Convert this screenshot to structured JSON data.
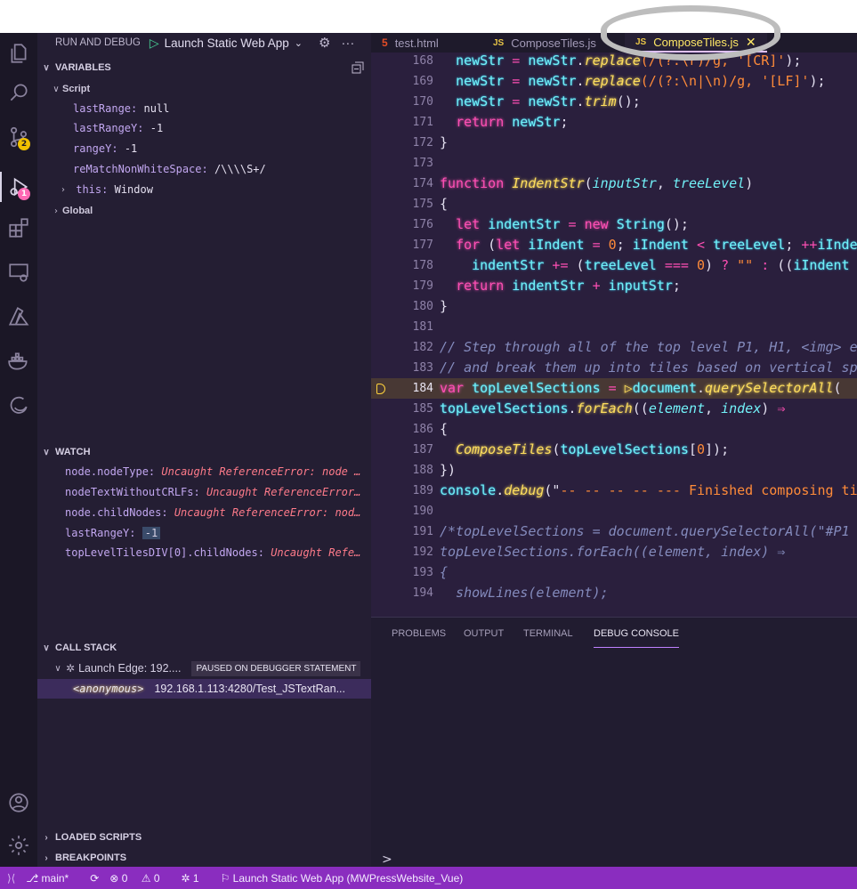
{
  "run_debug": {
    "title": "RUN AND DEBUG",
    "config": "Launch Static Web App"
  },
  "activity_bar": {
    "source_control_badge": "2",
    "debug_badge": "1"
  },
  "variables": {
    "title": "VARIABLES",
    "scope": "Script",
    "items": [
      {
        "key": "lastRange:",
        "value": "null"
      },
      {
        "key": "lastRangeY:",
        "value": "-1"
      },
      {
        "key": "rangeY:",
        "value": "-1"
      },
      {
        "key": "reMatchNonWhiteSpace:",
        "value": "/\\\\\\\\S+/"
      },
      {
        "key": "this:",
        "value": "Window"
      }
    ],
    "global": "Global"
  },
  "watch": {
    "title": "WATCH",
    "items": [
      {
        "key": "node.nodeType:",
        "value": "Uncaught ReferenceError: node …"
      },
      {
        "key": "nodeTextWithoutCRLFs:",
        "value": "Uncaught ReferenceError…"
      },
      {
        "key": "node.childNodes:",
        "value": "Uncaught ReferenceError: nod…"
      },
      {
        "key": "lastRangeY:",
        "value": "-1"
      },
      {
        "key": "topLevelTilesDIV[0].childNodes:",
        "value": "Uncaught Refe…"
      }
    ]
  },
  "call_stack": {
    "title": "CALL STACK",
    "thread": "Launch Edge: 192....",
    "paused": "PAUSED ON DEBUGGER STATEMENT",
    "frame_fn": "<anonymous>",
    "frame_loc": "192.168.1.113:4280/Test_JSTextRan..."
  },
  "bottom_sections": {
    "loaded_scripts": "LOADED SCRIPTS",
    "breakpoints": "BREAKPOINTS"
  },
  "tabs": [
    {
      "icon": "5",
      "label": "test.html"
    },
    {
      "icon": "JS",
      "label": "ComposeTiles.js"
    },
    {
      "icon": "JS",
      "label": "ComposeTiles.js",
      "close": "✕"
    }
  ],
  "editor": {
    "lines": [
      {
        "n": "168",
        "code": [
          [
            "  ",
            "pl"
          ],
          [
            "newStr",
            "id"
          ],
          [
            " = ",
            "op"
          ],
          [
            "newStr",
            "id"
          ],
          [
            ".",
            "pl"
          ],
          [
            "replace",
            "fn"
          ],
          [
            "(/(?:\\r)/g, ",
            "str"
          ],
          [
            "'[CR]'",
            "str"
          ],
          [
            ");",
            "pl"
          ]
        ]
      },
      {
        "n": "169",
        "code": [
          [
            "  ",
            "pl"
          ],
          [
            "newStr",
            "id"
          ],
          [
            " = ",
            "op"
          ],
          [
            "newStr",
            "id"
          ],
          [
            ".",
            "pl"
          ],
          [
            "replace",
            "fn"
          ],
          [
            "(/(?:\\n|\\n)/g, ",
            "str"
          ],
          [
            "'[LF]'",
            "str"
          ],
          [
            ");",
            "pl"
          ]
        ]
      },
      {
        "n": "170",
        "code": [
          [
            "  ",
            "pl"
          ],
          [
            "newStr",
            "id"
          ],
          [
            " = ",
            "op"
          ],
          [
            "newStr",
            "id"
          ],
          [
            ".",
            "pl"
          ],
          [
            "trim",
            "fn"
          ],
          [
            "();",
            "pl"
          ]
        ]
      },
      {
        "n": "171",
        "code": [
          [
            "  ",
            "pl"
          ],
          [
            "return",
            "kw"
          ],
          [
            " ",
            "pl"
          ],
          [
            "newStr",
            "id"
          ],
          [
            ";",
            "pl"
          ]
        ]
      },
      {
        "n": "172",
        "code": [
          [
            "}",
            "pl"
          ]
        ]
      },
      {
        "n": "173",
        "code": []
      },
      {
        "n": "174",
        "code": [
          [
            "function",
            "kw"
          ],
          [
            " ",
            "pl"
          ],
          [
            "IndentStr",
            "fn"
          ],
          [
            "(",
            "pl"
          ],
          [
            "inputStr",
            "par"
          ],
          [
            ", ",
            "pl"
          ],
          [
            "treeLevel",
            "par"
          ],
          [
            ")",
            "pl"
          ]
        ]
      },
      {
        "n": "175",
        "code": [
          [
            "{",
            "pl"
          ]
        ]
      },
      {
        "n": "176",
        "code": [
          [
            "  ",
            "pl"
          ],
          [
            "let",
            "kw"
          ],
          [
            " ",
            "pl"
          ],
          [
            "indentStr",
            "id"
          ],
          [
            " = ",
            "op"
          ],
          [
            "new",
            "kw"
          ],
          [
            " ",
            "pl"
          ],
          [
            "String",
            "id"
          ],
          [
            "();",
            "pl"
          ]
        ]
      },
      {
        "n": "177",
        "code": [
          [
            "  ",
            "pl"
          ],
          [
            "for",
            "kw"
          ],
          [
            " (",
            "pl"
          ],
          [
            "let",
            "kw"
          ],
          [
            " ",
            "pl"
          ],
          [
            "iIndent",
            "id"
          ],
          [
            " = ",
            "op"
          ],
          [
            "0",
            "str"
          ],
          [
            "; ",
            "pl"
          ],
          [
            "iIndent",
            "id"
          ],
          [
            " < ",
            "op"
          ],
          [
            "treeLevel",
            "id"
          ],
          [
            "; ",
            "pl"
          ],
          [
            "++",
            "op"
          ],
          [
            "iIndent",
            "id"
          ]
        ]
      },
      {
        "n": "178",
        "code": [
          [
            "    ",
            "pl"
          ],
          [
            "indentStr",
            "id"
          ],
          [
            " += ",
            "op"
          ],
          [
            "(",
            "pl"
          ],
          [
            "treeLevel",
            "id"
          ],
          [
            " === ",
            "op"
          ],
          [
            "0",
            "str"
          ],
          [
            ") ",
            "pl"
          ],
          [
            "?",
            "op"
          ],
          [
            " \"\" ",
            "str"
          ],
          [
            ":",
            "op"
          ],
          [
            " ((",
            "pl"
          ],
          [
            "iIndent",
            "id"
          ]
        ]
      },
      {
        "n": "179",
        "code": [
          [
            "  ",
            "pl"
          ],
          [
            "return",
            "kw"
          ],
          [
            " ",
            "pl"
          ],
          [
            "indentStr",
            "id"
          ],
          [
            " + ",
            "op"
          ],
          [
            "inputStr",
            "id"
          ],
          [
            ";",
            "pl"
          ]
        ]
      },
      {
        "n": "180",
        "code": [
          [
            "}",
            "pl"
          ]
        ]
      },
      {
        "n": "181",
        "code": []
      },
      {
        "n": "182",
        "code": [
          [
            "// Step through all of the top level P1, H1, <img> e",
            "cm"
          ]
        ]
      },
      {
        "n": "183",
        "code": [
          [
            "// and break them up into tiles based on vertical sp",
            "cm"
          ]
        ]
      },
      {
        "n": "184",
        "code": [
          [
            "var",
            "kw"
          ],
          [
            " ",
            "pl"
          ],
          [
            "topLevelSections",
            "id"
          ],
          [
            " = ",
            "op"
          ],
          [
            "▷",
            "fn"
          ],
          [
            "document",
            "id"
          ],
          [
            ".",
            "pl"
          ],
          [
            "querySelectorAll",
            "fn"
          ],
          [
            "(",
            "pl"
          ]
        ],
        "current": true
      },
      {
        "n": "185",
        "code": [
          [
            "topLevelSections",
            "id"
          ],
          [
            ".",
            "pl"
          ],
          [
            "forEach",
            "fn"
          ],
          [
            "((",
            "pl"
          ],
          [
            "element",
            "par"
          ],
          [
            ", ",
            "pl"
          ],
          [
            "index",
            "par"
          ],
          [
            ") ",
            "pl"
          ],
          [
            "⇒",
            "op"
          ]
        ]
      },
      {
        "n": "186",
        "code": [
          [
            "{",
            "pl"
          ]
        ]
      },
      {
        "n": "187",
        "code": [
          [
            "  ",
            "pl"
          ],
          [
            "ComposeTiles",
            "fn"
          ],
          [
            "(",
            "pl"
          ],
          [
            "topLevelSections",
            "id"
          ],
          [
            "[",
            "pl"
          ],
          [
            "0",
            "str"
          ],
          [
            "]);",
            "pl"
          ]
        ]
      },
      {
        "n": "188",
        "code": [
          [
            "})",
            "pl"
          ]
        ]
      },
      {
        "n": "189",
        "code": [
          [
            "console",
            "id"
          ],
          [
            ".",
            "pl"
          ],
          [
            "debug",
            "fn"
          ],
          [
            "(\"",
            "pl"
          ],
          [
            "-- -- -- -- --- Finished composing til",
            "str"
          ]
        ]
      },
      {
        "n": "190",
        "code": []
      },
      {
        "n": "191",
        "code": [
          [
            "/*topLevelSections = document.querySelectorAll(\"#P1",
            "cm"
          ]
        ]
      },
      {
        "n": "192",
        "code": [
          [
            "topLevelSections.forEach((element, index) ⇒",
            "cm"
          ]
        ]
      },
      {
        "n": "193",
        "code": [
          [
            "{",
            "cm"
          ]
        ]
      },
      {
        "n": "194",
        "code": [
          [
            "  showLines(element);",
            "cm"
          ]
        ]
      }
    ]
  },
  "panel": {
    "tabs": [
      "PROBLEMS",
      "OUTPUT",
      "TERMINAL",
      "DEBUG CONSOLE"
    ],
    "prompt": ">"
  },
  "status": {
    "branch": "main*",
    "errors": "0",
    "warnings": "0",
    "debug_sessions": "1",
    "launch": "Launch Static Web App (MWPressWebsite_Vue)"
  }
}
